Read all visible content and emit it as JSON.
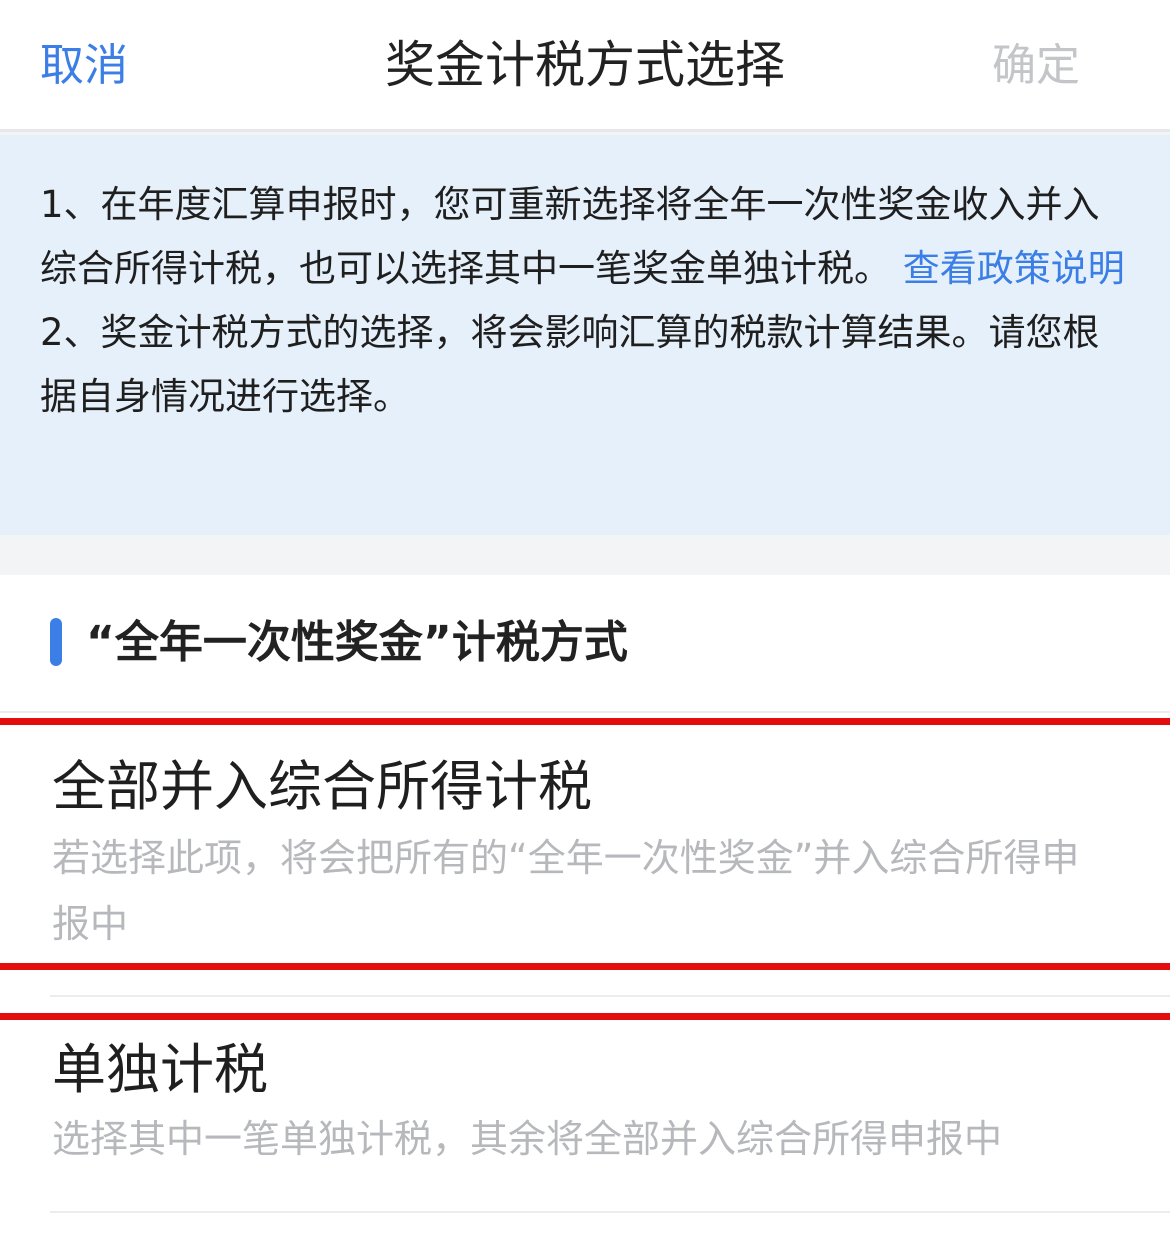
{
  "navbar": {
    "cancel_label": "取消",
    "title": "奖金计税方式选择",
    "confirm_label": "确定"
  },
  "notice": {
    "item1_text": "1、在年度汇算申报时，您可重新选择将全年一次性奖金收入并入综合所得计税，也可以选择其中一笔奖金单独计税。",
    "item1_link": "查看政策说明",
    "item2_text": "2、奖金计税方式的选择，将会影响汇算的税款计算结果。请您根据自身情况进行选择。"
  },
  "section": {
    "title": "“全年一次性奖金”计税方式",
    "options": [
      {
        "title": "全部并入综合所得计税",
        "description": "若选择此项，将会把所有的“全年一次性奖金”并入综合所得申报中"
      },
      {
        "title": "单独计税",
        "description": "选择其中一笔单独计税，其余将全部并入综合所得申报中"
      }
    ]
  },
  "colors": {
    "accent": "#3a7ee6",
    "notice_bg": "#e6f0fa",
    "highlight": "#e40d0d",
    "disabled_text": "#c3c5c9"
  }
}
